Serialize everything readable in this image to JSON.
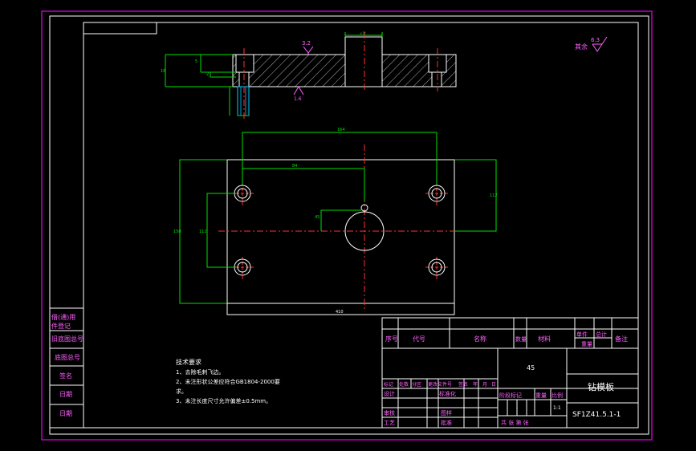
{
  "drawing": {
    "part_name": "钻模板",
    "drawing_number": "SF1Z41.5.1-1",
    "material": "45",
    "scale": "1:1",
    "roughness_rest_label": "其余",
    "roughness_rest_value": "6.3",
    "roughness_top": "3.2",
    "roughness_bottom": "1.6"
  },
  "tech_requirements": {
    "title": "技术要求",
    "items": [
      "1、去除毛刺飞边。",
      "2、未注形状公差应符合GB1804-2000要",
      "求。",
      "3、未注长度尺寸允许偏差±0.5mm。"
    ]
  },
  "side_stamp": [
    "借(通)用",
    "件登记",
    "旧底图总号",
    "底图总号",
    "签名",
    "日期",
    "日期"
  ],
  "bom_header": [
    "序号",
    "代号",
    "名称",
    "数量",
    "材料",
    "单件",
    "总计",
    "重量",
    "备注"
  ],
  "title_block": {
    "rev_header": [
      "标记",
      "处数",
      "分区",
      "更改文件号",
      "签名",
      "年",
      "月",
      "日"
    ],
    "design": "设计",
    "standardization": "标准化",
    "review": "审核",
    "drawing_check": "图样",
    "approve": "批准",
    "process": "工艺",
    "stage_mark": "阶段标记",
    "weight": "重量",
    "ratio": "比例",
    "sheets": "共 张 第 张"
  },
  "dims": {
    "top_width": "×??",
    "top_left_h1": "5",
    "top_left_h2": "2",
    "top_left_total": "18",
    "plan_hole_span": "164",
    "plan_half": "84",
    "plan_total_width": "410",
    "plan_height": "150",
    "plan_inner_h": "112",
    "plan_left_h": "112",
    "plan_center_offset": "45"
  }
}
